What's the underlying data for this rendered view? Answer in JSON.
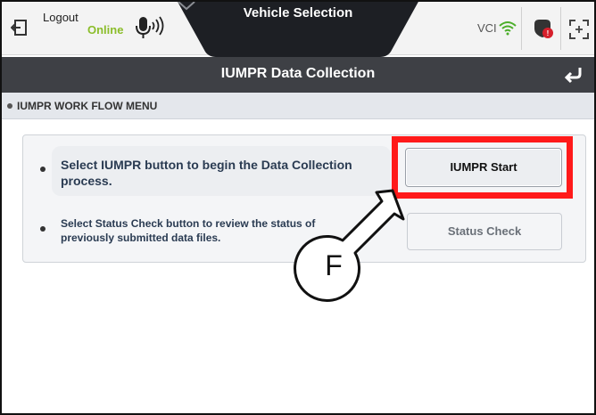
{
  "topbar": {
    "logout_label": "Logout",
    "status_label": "Online",
    "vehicle_selection_label": "Vehicle Selection",
    "vci_label": "VCI",
    "online_color": "#8bbd2a",
    "icons": [
      "logout-icon",
      "microphone-icon",
      "chevron-down-icon",
      "wifi-icon",
      "dtc-icon",
      "screen-capture-icon"
    ]
  },
  "titlebar": {
    "title": "IUMPR Data Collection",
    "back_icon": "return-arrow-icon"
  },
  "section": {
    "title": "IUMPR WORK FLOW MENU"
  },
  "workflow": {
    "items": [
      {
        "text": "Select IUMPR button to begin the Data Collection process.",
        "button_label": "IUMPR Start"
      },
      {
        "text": "Select Status Check button to review the status of previously submitted data files.",
        "button_label": "Status Check"
      }
    ]
  },
  "annotation": {
    "callout_letter": "F",
    "highlight_color": "#ff1a1a"
  }
}
